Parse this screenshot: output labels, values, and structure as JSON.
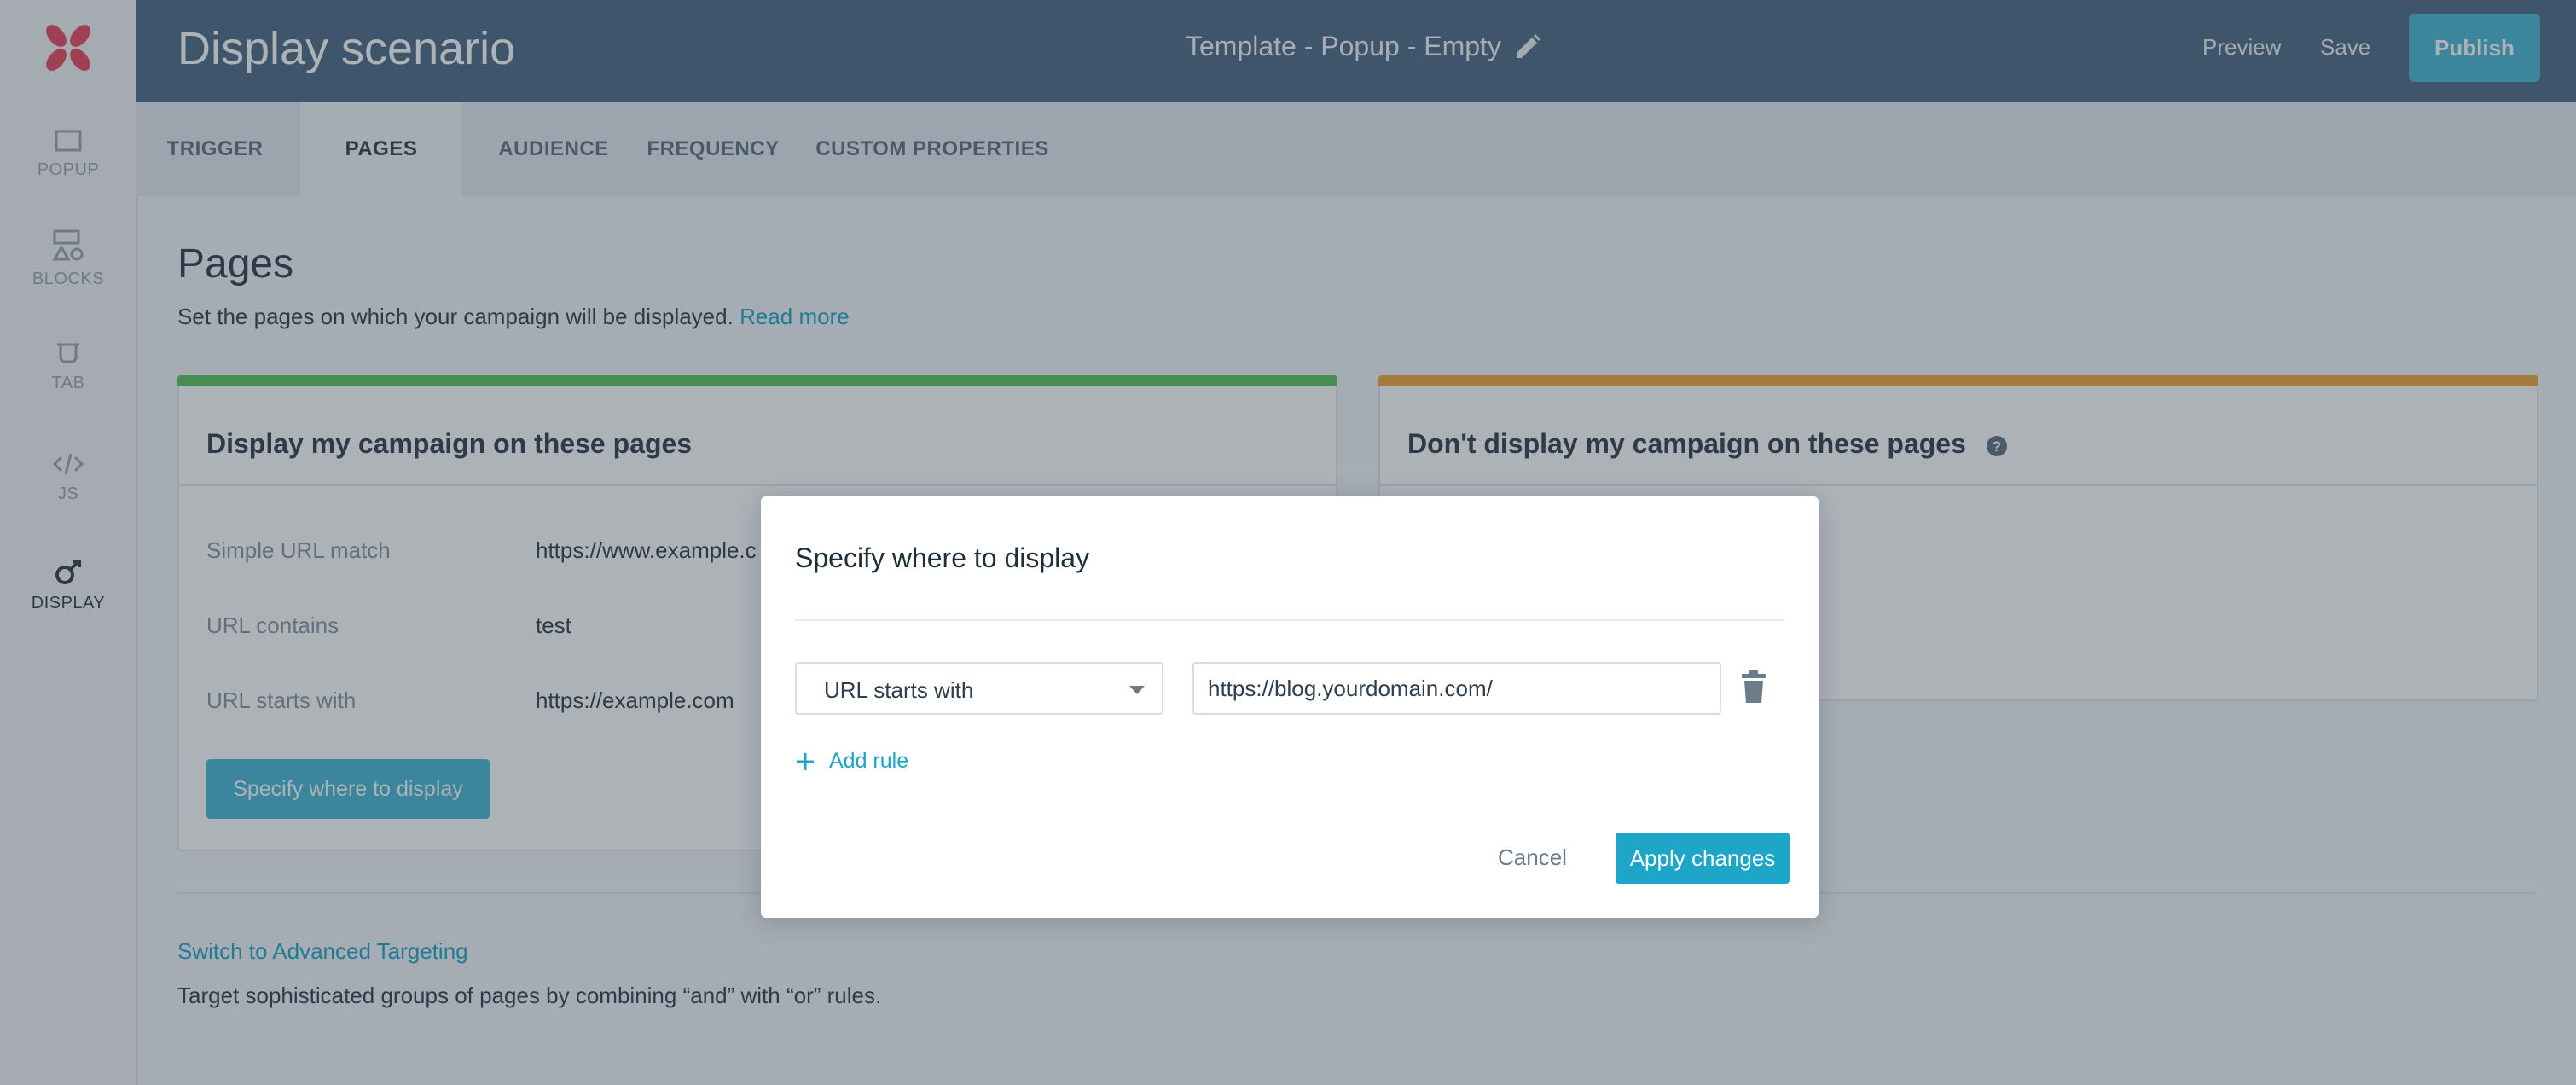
{
  "sidebar": {
    "items": [
      {
        "label": "POPUP",
        "icon": "popup-icon"
      },
      {
        "label": "BLOCKS",
        "icon": "blocks-icon"
      },
      {
        "label": "TAB",
        "icon": "tab-icon"
      },
      {
        "label": "JS",
        "icon": "code-icon"
      },
      {
        "label": "DISPLAY",
        "icon": "display-icon",
        "active": true
      }
    ]
  },
  "header": {
    "title": "Display scenario",
    "template_name": "Template - Popup - Empty",
    "preview_label": "Preview",
    "save_label": "Save",
    "publish_label": "Publish"
  },
  "tabs": [
    {
      "label": "TRIGGER"
    },
    {
      "label": "PAGES",
      "active": true
    },
    {
      "label": "AUDIENCE"
    },
    {
      "label": "FREQUENCY"
    },
    {
      "label": "CUSTOM PROPERTIES"
    }
  ],
  "main": {
    "title": "Pages",
    "description": "Set the pages on which your campaign will be displayed.",
    "read_more": "Read more",
    "include_card": {
      "title": "Display my campaign on these pages",
      "rules": [
        {
          "label": "Simple URL match",
          "value": "https://www.example.c"
        },
        {
          "label": "URL contains",
          "value": "test"
        },
        {
          "label": "URL starts with",
          "value": "https://example.com"
        }
      ],
      "button_label": "Specify where to display"
    },
    "exclude_card": {
      "title": "Don't display my campaign on these pages"
    },
    "advanced_link": "Switch to Advanced Targeting",
    "advanced_desc": "Target sophisticated groups of pages by combining “and” with “or” rules."
  },
  "modal": {
    "title": "Specify where to display",
    "rule_type": "URL starts with",
    "rule_value": "https://blog.yourdomain.com/",
    "add_rule": "Add rule",
    "cancel": "Cancel",
    "apply": "Apply changes"
  },
  "colors": {
    "topbar": "#4e6a86",
    "accent": "#1ea6c8",
    "include_bar": "#5cc55d",
    "exclude_bar": "#f2a53b",
    "logo": "#e84a5f"
  }
}
